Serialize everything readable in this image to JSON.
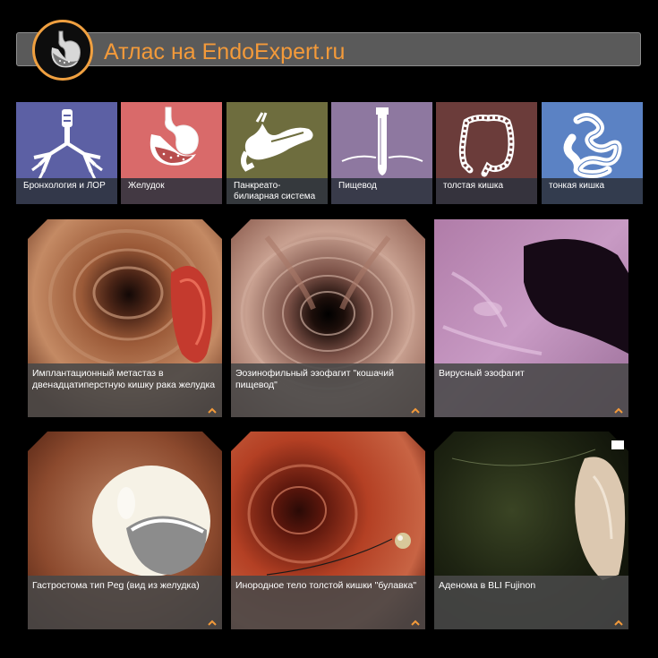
{
  "header": {
    "title": "Атлас на EndoExpert.ru",
    "logo_icon": "stomach-logo-icon",
    "accent": "#f39a3a"
  },
  "categories": [
    {
      "label": "Бронхология и ЛОР",
      "color": "#5c60a4",
      "icon": "lungs-icon"
    },
    {
      "label": "Желудок",
      "color": "#d96a6a",
      "icon": "stomach-icon"
    },
    {
      "label": "Панкреато-билиарная система",
      "color": "#6e6d3e",
      "icon": "pancreas-icon"
    },
    {
      "label": "Пищевод",
      "color": "#8e78a0",
      "icon": "esophagus-icon"
    },
    {
      "label": "толстая кишка",
      "color": "#6b3c3a",
      "icon": "colon-icon"
    },
    {
      "label": "тонкая кишка",
      "color": "#5b82c4",
      "icon": "small-intestine-icon"
    }
  ],
  "cards": [
    {
      "caption": "Имплантационный метастаз в двенадцатиперстную кишку рака желудка"
    },
    {
      "caption": "Эозинофильный эзофагит \"кошачий пищевод\""
    },
    {
      "caption": "Вирусный эзофагит"
    },
    {
      "caption": "Гастростома тип Peg (вид из желудка)"
    },
    {
      "caption": "Инородное тело толстой кишки \"булавка\""
    },
    {
      "caption": "Аденома в BLI Fujinon"
    }
  ]
}
